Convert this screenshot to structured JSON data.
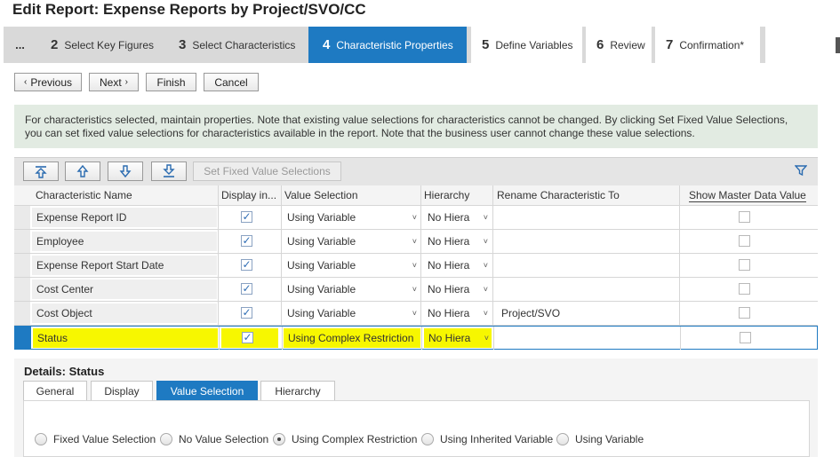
{
  "window": {
    "title": "Edit Report: Expense Reports by Project/SVO/CC"
  },
  "wizard": {
    "overflow": "...",
    "steps": [
      {
        "num": "2",
        "label": "Select Key Figures"
      },
      {
        "num": "3",
        "label": "Select Characteristics"
      },
      {
        "num": "4",
        "label": "Characteristic Properties"
      },
      {
        "num": "5",
        "label": "Define Variables"
      },
      {
        "num": "6",
        "label": "Review"
      },
      {
        "num": "7",
        "label": "Confirmation*"
      }
    ]
  },
  "nav": {
    "previous": "Previous",
    "next": "Next",
    "finish": "Finish",
    "cancel": "Cancel"
  },
  "info": {
    "line1": "For characteristics selected, maintain properties. Note that existing value selections for characteristics cannot be changed. By clicking Set Fixed Value Selections,",
    "line2": "you can set fixed value selections for characteristics available in the report. Note that the business user cannot change these value selections."
  },
  "toolbar": {
    "set_fixed": "Set Fixed Value Selections"
  },
  "table": {
    "headers": {
      "name": "Characteristic Name",
      "display": "Display in...",
      "value": "Value Selection",
      "hierarchy": "Hierarchy",
      "rename": "Rename Characteristic To",
      "master": "Show Master Data Value"
    },
    "rows": [
      {
        "name": "Expense Report ID",
        "value": "Using Variable",
        "hierarchy": "No Hiera",
        "rename": ""
      },
      {
        "name": "Employee",
        "value": "Using Variable",
        "hierarchy": "No Hiera",
        "rename": ""
      },
      {
        "name": "Expense Report Start Date",
        "value": "Using Variable",
        "hierarchy": "No Hiera",
        "rename": ""
      },
      {
        "name": "Cost Center",
        "value": "Using Variable",
        "hierarchy": "No Hiera",
        "rename": ""
      },
      {
        "name": "Cost Object",
        "value": "Using Variable",
        "hierarchy": "No Hiera",
        "rename": "Project/SVO"
      },
      {
        "name": "Status",
        "value": "Using Complex Restriction",
        "hierarchy": "No Hiera",
        "rename": ""
      }
    ]
  },
  "details": {
    "title": "Details: Status",
    "tabs": [
      "General",
      "Display",
      "Value Selection",
      "Hierarchy"
    ],
    "radios": [
      "Fixed Value Selection",
      "No Value Selection",
      "Using Complex Restriction",
      "Using Inherited Variable",
      "Using Variable"
    ]
  },
  "colors": {
    "accent": "#1e7ac2",
    "highlight": "#f7f700",
    "info_bg": "#e2ebe2"
  }
}
